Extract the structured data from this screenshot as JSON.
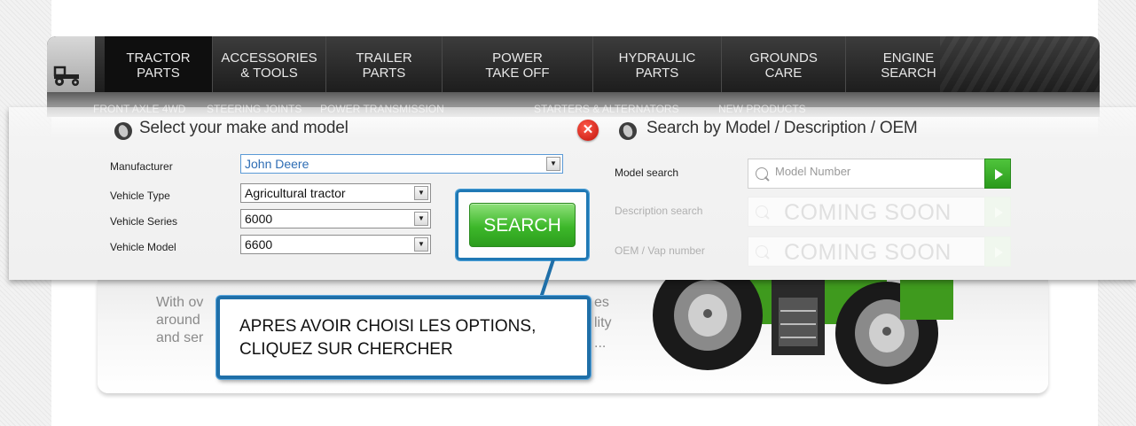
{
  "nav": {
    "items": [
      {
        "label": "TRACTOR\nPARTS",
        "line1": "TRACTOR",
        "line2": "PARTS",
        "active": true
      },
      {
        "label": "ACCESSORIES\n& TOOLS",
        "line1": "ACCESSORIES",
        "line2": "& TOOLS",
        "active": false
      },
      {
        "label": "TRAILER\nPARTS",
        "line1": "TRAILER",
        "line2": "PARTS",
        "active": false
      },
      {
        "label": "POWER\nTAKE OFF",
        "line1": "POWER",
        "line2": "TAKE OFF",
        "active": false
      },
      {
        "label": "HYDRAULIC\nPARTS",
        "line1": "HYDRAULIC",
        "line2": "PARTS",
        "active": false
      },
      {
        "label": "GROUNDS\nCARE",
        "line1": "GROUNDS",
        "line2": "CARE",
        "active": false
      },
      {
        "label": "ENGINE\nSEARCH",
        "line1": "ENGINE",
        "line2": "SEARCH",
        "active": false
      }
    ],
    "home_icon": "tractor-icon"
  },
  "subnav": {
    "items": [
      "FRONT AXLE 4WD",
      "STEERING JOINTS",
      "POWER TRANSMISSION",
      "STARTERS & ALTERNATORS",
      "NEW PRODUCTS"
    ]
  },
  "left_panel": {
    "title": "Select your make and model",
    "fields": [
      {
        "label": "Manufacturer",
        "value": "John Deere"
      },
      {
        "label": "Vehicle Type",
        "value": "Agricultural tractor"
      },
      {
        "label": "Vehicle Series",
        "value": "6000"
      },
      {
        "label": "Vehicle Model",
        "value": "6600"
      }
    ],
    "search_button": "SEARCH"
  },
  "right_panel": {
    "title": "Search by Model / Description / OEM",
    "rows": [
      {
        "label": "Model search",
        "placeholder": "Model Number",
        "enabled": true
      },
      {
        "label": "Description search",
        "placeholder": "COMING SOON",
        "enabled": false
      },
      {
        "label": "OEM / Vap number",
        "placeholder": "COMING SOON",
        "enabled": false
      }
    ]
  },
  "banner": {
    "line1_left": "With ov",
    "line1_right": "es",
    "line2_left": "around",
    "line2_right": "lity",
    "line3_left": "and ser",
    "line3_right": "..."
  },
  "callout": {
    "line1": "APRES AVOIR CHOISI LES OPTIONS,",
    "line2": "CLIQUEZ SUR CHERCHER"
  },
  "colors": {
    "accent_blue": "#1f6fa8",
    "search_green": "#3db82a",
    "close_red": "#d9231a",
    "link_blue": "#2e6db4"
  }
}
